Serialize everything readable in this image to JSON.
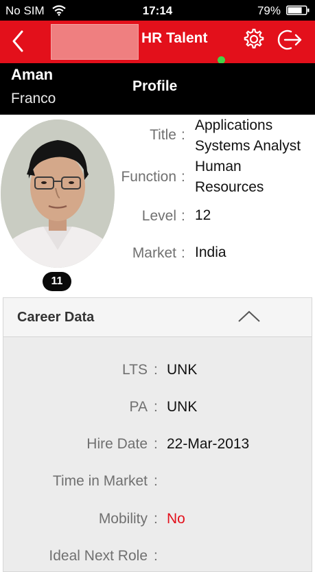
{
  "status_bar": {
    "carrier": "No SIM",
    "time": "17:14",
    "battery": "79%",
    "battery_level": 0.79
  },
  "app_bar": {
    "title": "HR Talent",
    "online_color": "#47d147",
    "brand_color": "#e3101b"
  },
  "employee": {
    "first_name": "Aman",
    "last_name": "Franco",
    "section_title": "Profile",
    "badge": "11"
  },
  "profile_fields": {
    "title": {
      "label": "Title",
      "value_line1": "Applications",
      "value_line2": "Systems Analyst"
    },
    "function": {
      "label": "Function",
      "value_line1": "Human",
      "value_line2": "Resources"
    },
    "level": {
      "label": "Level",
      "value": "12"
    },
    "market": {
      "label": "Market",
      "value": "India"
    },
    "separator": ":"
  },
  "career": {
    "title": "Career Data",
    "rows": {
      "lts": {
        "label": "LTS",
        "value": "UNK"
      },
      "pa": {
        "label": "PA",
        "value": "UNK"
      },
      "hire_date": {
        "label": "Hire Date",
        "value": "22-Mar-2013"
      },
      "time_in_market": {
        "label": "Time in Market",
        "value": ""
      },
      "mobility": {
        "label": "Mobility",
        "value": "No"
      },
      "ideal_next_role": {
        "label": "Ideal Next Role",
        "value": ""
      }
    }
  }
}
